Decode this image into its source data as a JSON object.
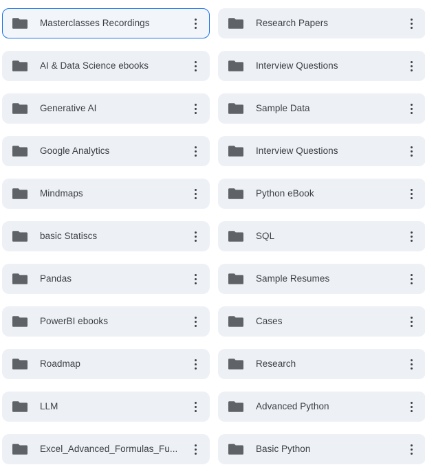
{
  "view": {
    "name": "folder-grid",
    "layout": "two-column-list",
    "columns": 2,
    "card_background": "#edf0f5",
    "selected_border_color": "#1a73e8",
    "folder_icon_color": "#5f6368",
    "text_color": "#3c4043"
  },
  "icons": {
    "folder": "folder-icon",
    "overflow_menu": "kebab-menu-icon"
  },
  "folders": [
    {
      "name": "Masterclasses Recordings",
      "column": "left",
      "selected": true,
      "menu_label": "More actions"
    },
    {
      "name": "Research Papers",
      "column": "right",
      "selected": false,
      "menu_label": "More actions"
    },
    {
      "name": "AI & Data Science ebooks",
      "column": "left",
      "selected": false,
      "menu_label": "More actions"
    },
    {
      "name": "Interview Questions",
      "column": "right",
      "selected": false,
      "menu_label": "More actions"
    },
    {
      "name": "Generative AI",
      "column": "left",
      "selected": false,
      "menu_label": "More actions"
    },
    {
      "name": "Sample Data",
      "column": "right",
      "selected": false,
      "menu_label": "More actions"
    },
    {
      "name": "Google Analytics",
      "column": "left",
      "selected": false,
      "menu_label": "More actions"
    },
    {
      "name": "Interview Questions",
      "column": "right",
      "selected": false,
      "menu_label": "More actions"
    },
    {
      "name": "Mindmaps",
      "column": "left",
      "selected": false,
      "menu_label": "More actions"
    },
    {
      "name": "Python eBook",
      "column": "right",
      "selected": false,
      "menu_label": "More actions"
    },
    {
      "name": "basic Statiscs",
      "column": "left",
      "selected": false,
      "menu_label": "More actions"
    },
    {
      "name": "SQL",
      "column": "right",
      "selected": false,
      "menu_label": "More actions"
    },
    {
      "name": "Pandas",
      "column": "left",
      "selected": false,
      "menu_label": "More actions"
    },
    {
      "name": "Sample Resumes",
      "column": "right",
      "selected": false,
      "menu_label": "More actions"
    },
    {
      "name": "PowerBI ebooks",
      "column": "left",
      "selected": false,
      "menu_label": "More actions"
    },
    {
      "name": "Cases",
      "column": "right",
      "selected": false,
      "menu_label": "More actions"
    },
    {
      "name": "Roadmap",
      "column": "left",
      "selected": false,
      "menu_label": "More actions"
    },
    {
      "name": "Research",
      "column": "right",
      "selected": false,
      "menu_label": "More actions"
    },
    {
      "name": "LLM",
      "column": "left",
      "selected": false,
      "menu_label": "More actions"
    },
    {
      "name": "Advanced Python",
      "column": "right",
      "selected": false,
      "menu_label": "More actions"
    },
    {
      "name": "Excel_Advanced_Formulas_Functions_Guide",
      "display_name": "Excel_Advanced_Formulas_Fu...",
      "column": "left",
      "selected": false,
      "menu_label": "More actions"
    },
    {
      "name": "Basic Python",
      "column": "right",
      "selected": false,
      "menu_label": "More actions"
    }
  ]
}
